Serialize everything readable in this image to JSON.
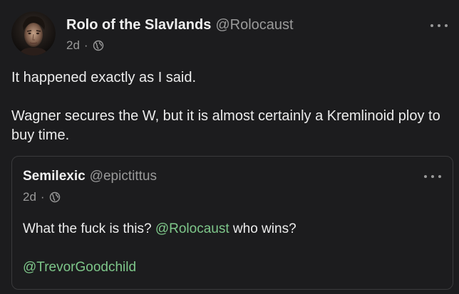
{
  "post": {
    "display_name": "Rolo of the Slavlands",
    "handle": "@Rolocaust",
    "time": "2d",
    "separator": "·",
    "visibility_icon": "globe-icon",
    "more_icon": "more-horizontal-icon",
    "text_line1": "It happened exactly as I said.",
    "text_line2": "Wagner secures the W, but it is almost certainly a Kremlinoid ploy to buy time."
  },
  "quote": {
    "display_name": "Semilexic",
    "handle": "@epictittus",
    "time": "2d",
    "separator": "·",
    "visibility_icon": "globe-icon",
    "more_icon": "more-horizontal-icon",
    "text_before": "What the fuck is this? ",
    "mention1": "@Rolocaust",
    "text_after": " who wins?",
    "mention2": "@TrevorGoodchild"
  },
  "colors": {
    "background": "#1c1c1e",
    "mention": "#7ec78a",
    "muted": "#9a9a9a",
    "border": "#3a3a3c"
  }
}
